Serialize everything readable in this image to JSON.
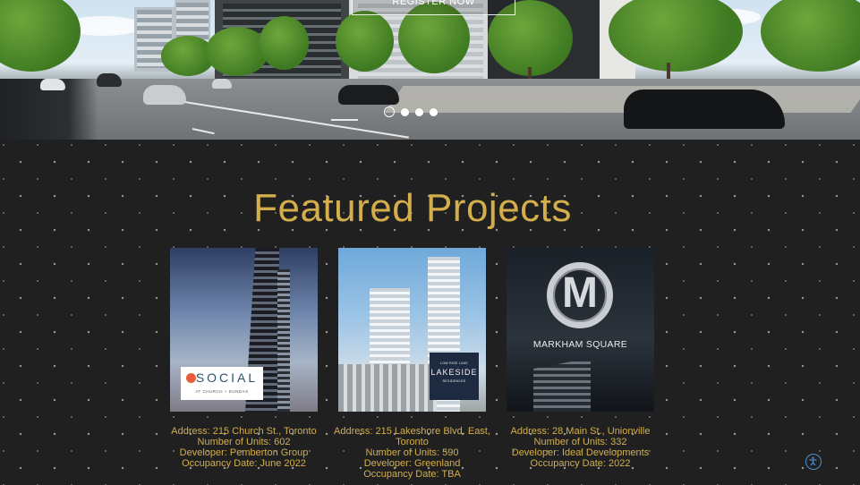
{
  "hero": {
    "register_label": "REGISTER NOW",
    "slides": 4,
    "active_slide": 1
  },
  "featured": {
    "title": "Featured Projects",
    "projects": [
      {
        "logo_text": "SOCIAL",
        "logo_subtext": "AT CHURCH + DUNDAS",
        "address": "Address: 215 Church St., Toronto",
        "units": "Number of Units: 602",
        "developer": "Developer: Pemberton Group",
        "occupancy": "Occupancy Date: June 2022"
      },
      {
        "logo_text": "LAKESIDE",
        "logo_subtext": "RESIDENCES",
        "logo_toptext": "LOW RISE LAKE",
        "address": "Address: 215 Lakeshore Blvd. East, Toronto",
        "units": "Number of Units: 590",
        "developer": "Developer: Greenland",
        "occupancy": "Occupancy Date: TBA"
      },
      {
        "logo_text": "MARKHAM SQUARE",
        "logo_letter": "M",
        "address": "Address: 28 Main St., Unionville",
        "units": "Number of Units: 332",
        "developer": "Developer: Ideal Developments",
        "occupancy": "Occupancy Date: 2022"
      }
    ]
  },
  "colors": {
    "accent_gold": "#d4ae4b",
    "background": "#1e1e1e",
    "accessibility_blue": "#4f8fd0"
  },
  "icons": {
    "accessibility": "accessibility-icon"
  }
}
